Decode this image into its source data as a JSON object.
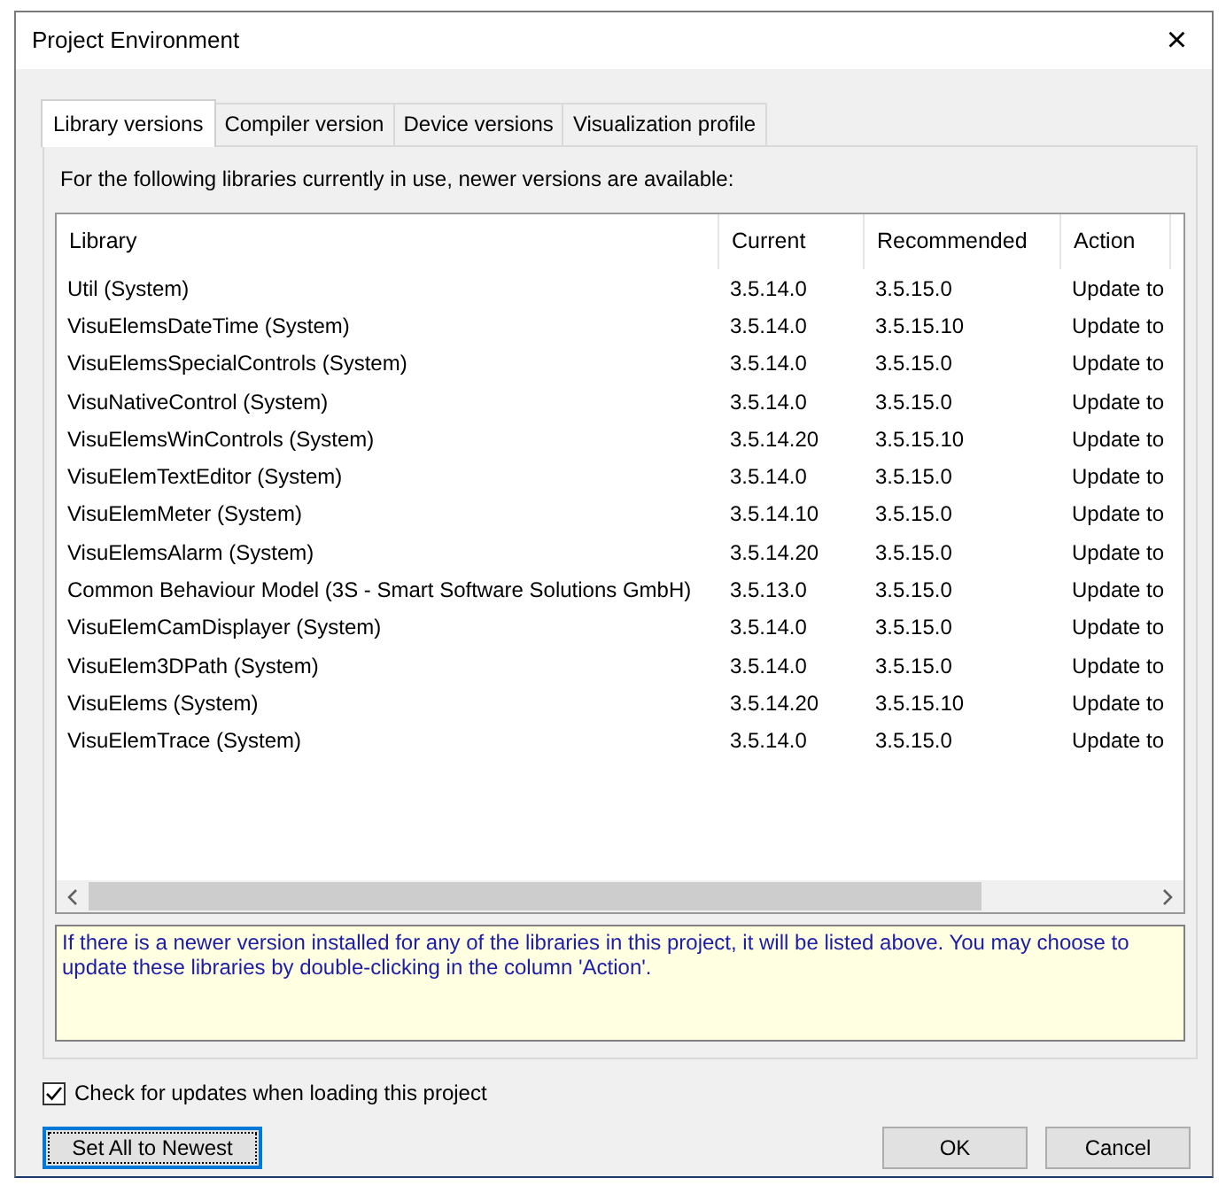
{
  "window": {
    "title": "Project Environment",
    "close": "×"
  },
  "tabs": [
    {
      "label": "Library versions",
      "selected": true
    },
    {
      "label": "Compiler version",
      "selected": false
    },
    {
      "label": "Device versions",
      "selected": false
    },
    {
      "label": "Visualization profile",
      "selected": false
    }
  ],
  "intro": "For the following libraries currently in use, newer versions are available:",
  "table": {
    "columns": [
      "Library",
      "Current",
      "Recommended",
      "Action"
    ],
    "rows": [
      [
        "Util (System)",
        "3.5.14.0",
        "3.5.15.0",
        "Update to"
      ],
      [
        "VisuElemsDateTime (System)",
        "3.5.14.0",
        "3.5.15.10",
        "Update to"
      ],
      [
        "VisuElemsSpecialControls (System)",
        "3.5.14.0",
        "3.5.15.0",
        "Update to"
      ],
      [
        "VisuNativeControl (System)",
        "3.5.14.0",
        "3.5.15.0",
        "Update to"
      ],
      [
        "VisuElemsWinControls (System)",
        "3.5.14.20",
        "3.5.15.10",
        "Update to"
      ],
      [
        "VisuElemTextEditor (System)",
        "3.5.14.0",
        "3.5.15.0",
        "Update to"
      ],
      [
        "VisuElemMeter (System)",
        "3.5.14.10",
        "3.5.15.0",
        "Update to"
      ],
      [
        "VisuElemsAlarm (System)",
        "3.5.14.20",
        "3.5.15.0",
        "Update to"
      ],
      [
        "Common Behaviour Model (3S - Smart Software Solutions GmbH)",
        "3.5.13.0",
        "3.5.15.0",
        "Update to"
      ],
      [
        "VisuElemCamDisplayer (System)",
        "3.5.14.0",
        "3.5.15.0",
        "Update to"
      ],
      [
        "VisuElem3DPath (System)",
        "3.5.14.0",
        "3.5.15.0",
        "Update to"
      ],
      [
        "VisuElems (System)",
        "3.5.14.20",
        "3.5.15.10",
        "Update to"
      ],
      [
        "VisuElemTrace (System)",
        "3.5.14.0",
        "3.5.15.0",
        "Update to"
      ]
    ]
  },
  "info": "If there is a newer version installed for any of the libraries in this project, it will be listed above. You may choose to update these libraries by double-clicking in the column 'Action'.",
  "check_updates": {
    "label": "Check for updates when loading this project",
    "checked": true
  },
  "buttons": [
    {
      "label": "Set All to Newest",
      "kind": "left",
      "focused": true
    },
    {
      "label": "OK",
      "kind": "right",
      "focused": false
    },
    {
      "label": "Cancel",
      "kind": "right",
      "focused": false
    }
  ]
}
